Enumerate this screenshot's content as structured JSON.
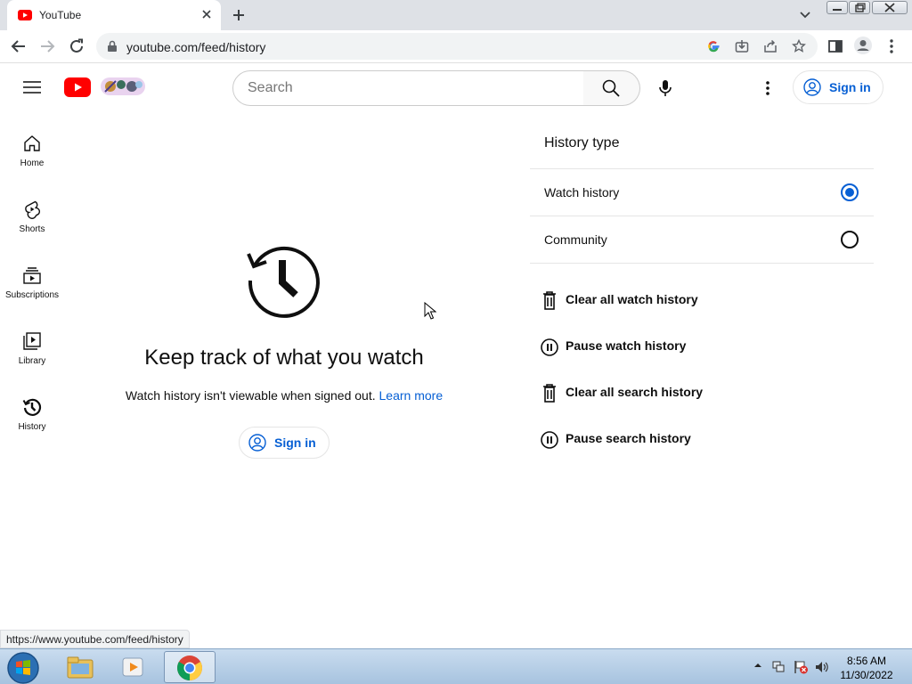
{
  "browser": {
    "tab_title": "YouTube",
    "url": "youtube.com/feed/history",
    "status_url": "https://www.youtube.com/feed/history"
  },
  "header": {
    "search_placeholder": "Search",
    "signin_label": "Sign in"
  },
  "sidebar": {
    "items": [
      {
        "label": "Home"
      },
      {
        "label": "Shorts"
      },
      {
        "label": "Subscriptions"
      },
      {
        "label": "Library"
      },
      {
        "label": "History"
      }
    ]
  },
  "main": {
    "title": "Keep track of what you watch",
    "description": "Watch history isn't viewable when signed out.",
    "learn_more": "Learn more",
    "signin_label": "Sign in"
  },
  "history_panel": {
    "heading": "History type",
    "options": [
      {
        "label": "Watch history",
        "selected": true
      },
      {
        "label": "Community",
        "selected": false
      }
    ],
    "actions": [
      {
        "label": "Clear all watch history",
        "icon": "trash-icon"
      },
      {
        "label": "Pause watch history",
        "icon": "pause-icon"
      },
      {
        "label": "Clear all search history",
        "icon": "trash-icon"
      },
      {
        "label": "Pause search history",
        "icon": "pause-icon"
      }
    ]
  },
  "taskbar": {
    "time": "8:56 AM",
    "date": "11/30/2022"
  },
  "colors": {
    "accent_blue": "#065fd4",
    "youtube_red": "#ff0000",
    "chrome_frame": "#dee1e6"
  }
}
